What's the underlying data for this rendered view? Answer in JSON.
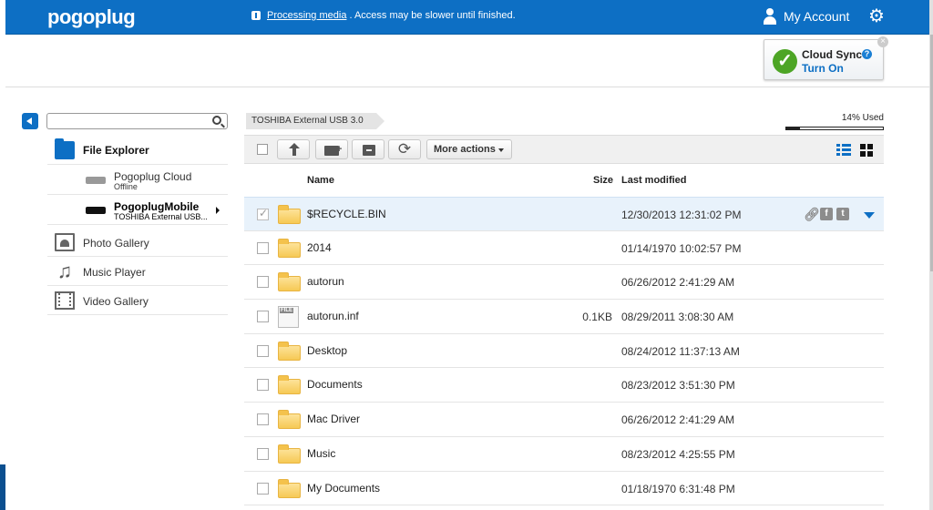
{
  "header": {
    "logo": "pogoplug",
    "notice_link": "Processing media",
    "notice_text": ". Access may be slower until finished.",
    "account_label": "My Account"
  },
  "cloud_sync": {
    "title": "Cloud Sync",
    "action": "Turn On",
    "help": "?",
    "close": "×"
  },
  "sidebar": {
    "search_placeholder": "",
    "file_explorer": "File Explorer",
    "devices": [
      {
        "name": "Pogoplug Cloud",
        "sub": "Offline"
      },
      {
        "name": "PogoplugMobile",
        "sub": "TOSHIBA External USB..."
      }
    ],
    "media": [
      "Photo Gallery",
      "Music Player",
      "Video Gallery"
    ]
  },
  "main": {
    "breadcrumb": "TOSHIBA External USB 3.0",
    "usage_label": "14% Used",
    "usage_fraction": 0.14,
    "more_actions": "More actions",
    "columns": {
      "name": "Name",
      "size": "Size",
      "modified": "Last modified"
    },
    "files": [
      {
        "name": "$RECYCLE.BIN",
        "size": "",
        "modified": "12/30/2013 12:31:02 PM",
        "type": "folder",
        "selected": true
      },
      {
        "name": "2014",
        "size": "",
        "modified": "01/14/1970 10:02:57 PM",
        "type": "folder"
      },
      {
        "name": "autorun",
        "size": "",
        "modified": "06/26/2012 2:41:29 AM",
        "type": "folder"
      },
      {
        "name": "autorun.inf",
        "size": "0.1KB",
        "modified": "08/29/2011 3:08:30 AM",
        "type": "file"
      },
      {
        "name": "Desktop",
        "size": "",
        "modified": "08/24/2012 11:37:13 AM",
        "type": "folder"
      },
      {
        "name": "Documents",
        "size": "",
        "modified": "08/23/2012 3:51:30 PM",
        "type": "folder"
      },
      {
        "name": "Mac Driver",
        "size": "",
        "modified": "06/26/2012 2:41:29 AM",
        "type": "folder"
      },
      {
        "name": "Music",
        "size": "",
        "modified": "08/23/2012 4:25:55 PM",
        "type": "folder"
      },
      {
        "name": "My Documents",
        "size": "",
        "modified": "01/18/1970 6:31:48 PM",
        "type": "folder"
      }
    ]
  },
  "colors": {
    "brand_blue": "#0d6fc4",
    "folder_yellow": "#f6c955",
    "success_green": "#4da526"
  }
}
